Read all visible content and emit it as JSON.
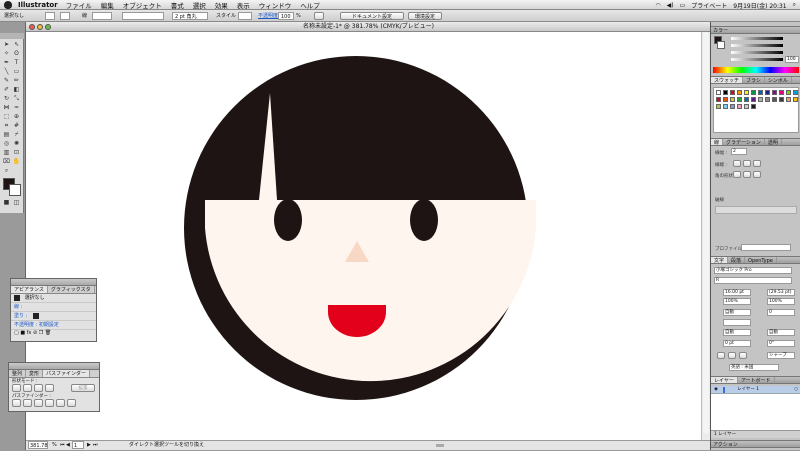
{
  "menubar": {
    "app_name": "Illustrator",
    "items": [
      "ファイル",
      "編集",
      "オブジェクト",
      "書式",
      "選択",
      "効果",
      "表示",
      "ウィンドウ",
      "ヘルプ"
    ],
    "user": "プライベート",
    "clock": "9月19日(金) 20:31"
  },
  "control_bar": {
    "selection": "選択なし",
    "stroke_label": "線",
    "stroke_weight": "2 pt 角丸",
    "style_label": "スタイル",
    "opacity_label": "不透明度",
    "opacity_value": "100",
    "opacity_unit": "%",
    "doc_setup_button": "ドキュメント設定",
    "prefs_button": "環境設定"
  },
  "document": {
    "title": "名称未設定-1* @ 381.78% (CMYK/プレビュー)",
    "zoom": "381.78",
    "page": "1",
    "status_text": "ダイレクト選択ツールを切り換え"
  },
  "artwork": {
    "hair_color": "#1d1413",
    "skin_color": "#fdf5ee",
    "nose_color": "#f8d7c4",
    "mouth_color": "#e2001a"
  },
  "appearance_panel": {
    "tabs": [
      "アピアランス",
      "グラフィックスタ"
    ],
    "header": "選択なし",
    "rows": [
      "線 :",
      "塗り :",
      "不透明度 : 初期設定"
    ]
  },
  "pathfinder_panel": {
    "tabs": [
      "整列",
      "変形",
      "パスファインダー"
    ],
    "shape_mode_label": "形状モード :",
    "expand_button": "拡張",
    "pathfinder_label": "パスファインダー :"
  },
  "color_panel": {
    "tabs": [
      "カラー"
    ],
    "c_value": "",
    "k_value": "100"
  },
  "swatches_panel": {
    "tabs": [
      "スウォッチ",
      "ブラシ",
      "シンボル"
    ],
    "swatch_colors": [
      "#ffffff",
      "#000000",
      "#e60012",
      "#f39800",
      "#fff100",
      "#009944",
      "#0068b7",
      "#1d2088",
      "#920783",
      "#e4007f",
      "#8fc31f",
      "#00a0e9",
      "#c30d23",
      "#ea5504",
      "#d7c447",
      "#22ac38",
      "#036eb8",
      "#601986",
      "#b2b2b2",
      "#898989",
      "#595757",
      "#3e3a39",
      "#f29b76",
      "#fabe00",
      "#a3c94f",
      "#7ecef4",
      "#8c97cb",
      "#f19ec2",
      "#c9caca",
      "#231815"
    ]
  },
  "gradient_panel": {
    "tabs": [
      "線",
      "グラデーション",
      "透明"
    ],
    "weight_label": "線幅 :",
    "weight_value": "2",
    "cap_label": "線端 :",
    "corner_label": "角の形状 :",
    "dash_label": "破線",
    "profile_label": "プロファイル :"
  },
  "character_panel": {
    "tabs": [
      "文字",
      "段落",
      "OpenType"
    ],
    "font": "小塚ゴシック Pro",
    "style": "R",
    "size": "16.00 pt",
    "leading": "(29.53 pt)",
    "scale_v": "100%",
    "scale_h": "100%",
    "kerning": "自動",
    "tracking": "0",
    "baseline": "0 pt",
    "rotation": "0°",
    "language": "英語 : 米国",
    "aki_left": "自動",
    "aki_right": "自動",
    "sharp_label": "シャープ"
  },
  "layers_panel": {
    "tabs": [
      "レイヤー",
      "アートボード"
    ],
    "layer_name": "レイヤー 1",
    "footer_count": "1 レイヤー"
  },
  "actions_panel": {
    "title": "アクション"
  }
}
